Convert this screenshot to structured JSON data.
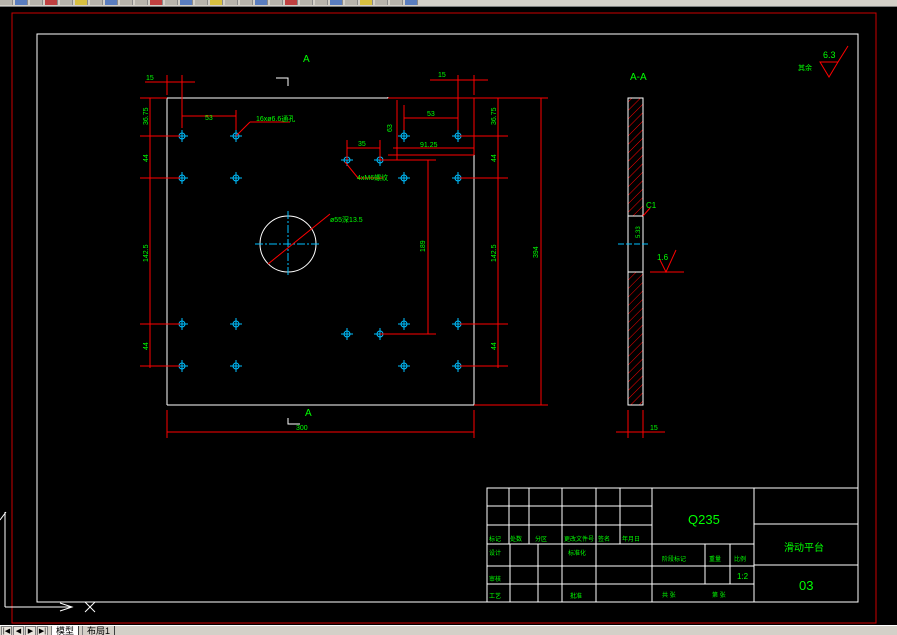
{
  "section_label_top": "A",
  "section_label_bottom": "A",
  "section_view_title": "A-A",
  "roughness_general": "6.3",
  "roughness_general_note": "其余",
  "roughness_side": "1.6",
  "chamfer_note": "C1",
  "dims": {
    "d15_left": "15",
    "d15_right": "15",
    "d53_left": "53",
    "d53_right": "53",
    "d63": "63",
    "d35": "35",
    "d9125": "91.25",
    "d3675_left": "36.75",
    "d3675_right": "36.75",
    "d44_1": "44",
    "d44_2": "44",
    "d44_3": "44",
    "d44_4": "44",
    "d1425_left": "142.5",
    "d1425_right": "142.5",
    "d189": "189",
    "d300": "300",
    "d394": "394",
    "d15_bottom": "15",
    "d_hole_depth": "5.33",
    "note_holes16": "16xø6.6通孔",
    "note_holes4": "4xM6螺纹",
    "note_big_hole": "ø55深13.5"
  },
  "title_block": {
    "material": "Q235",
    "part_name": "滑动平台",
    "drawing_no": "03",
    "scale": "1:2",
    "h_mark": "标记",
    "h_count": "处数",
    "h_zone": "分区",
    "h_change": "更改文件号",
    "h_sign": "签名",
    "h_date": "年月日",
    "h_design": "设计",
    "h_std": "标准化",
    "h_check": "审核",
    "h_craft": "工艺",
    "h_approve": "批准",
    "h_stage": "阶段标记",
    "h_weight": "重量",
    "h_ratio": "比例",
    "h_sheets": "共 张",
    "h_sheet": "第 张"
  },
  "tabs": {
    "model": "模型",
    "layout1": "布局1"
  },
  "colors": {
    "background": "#000000",
    "outline": "#ffffff",
    "dimension": "#ff0000",
    "text": "#00ff00",
    "centerline": "#00bfff",
    "hatch": "#ff0000",
    "frame": "#cc0000"
  }
}
